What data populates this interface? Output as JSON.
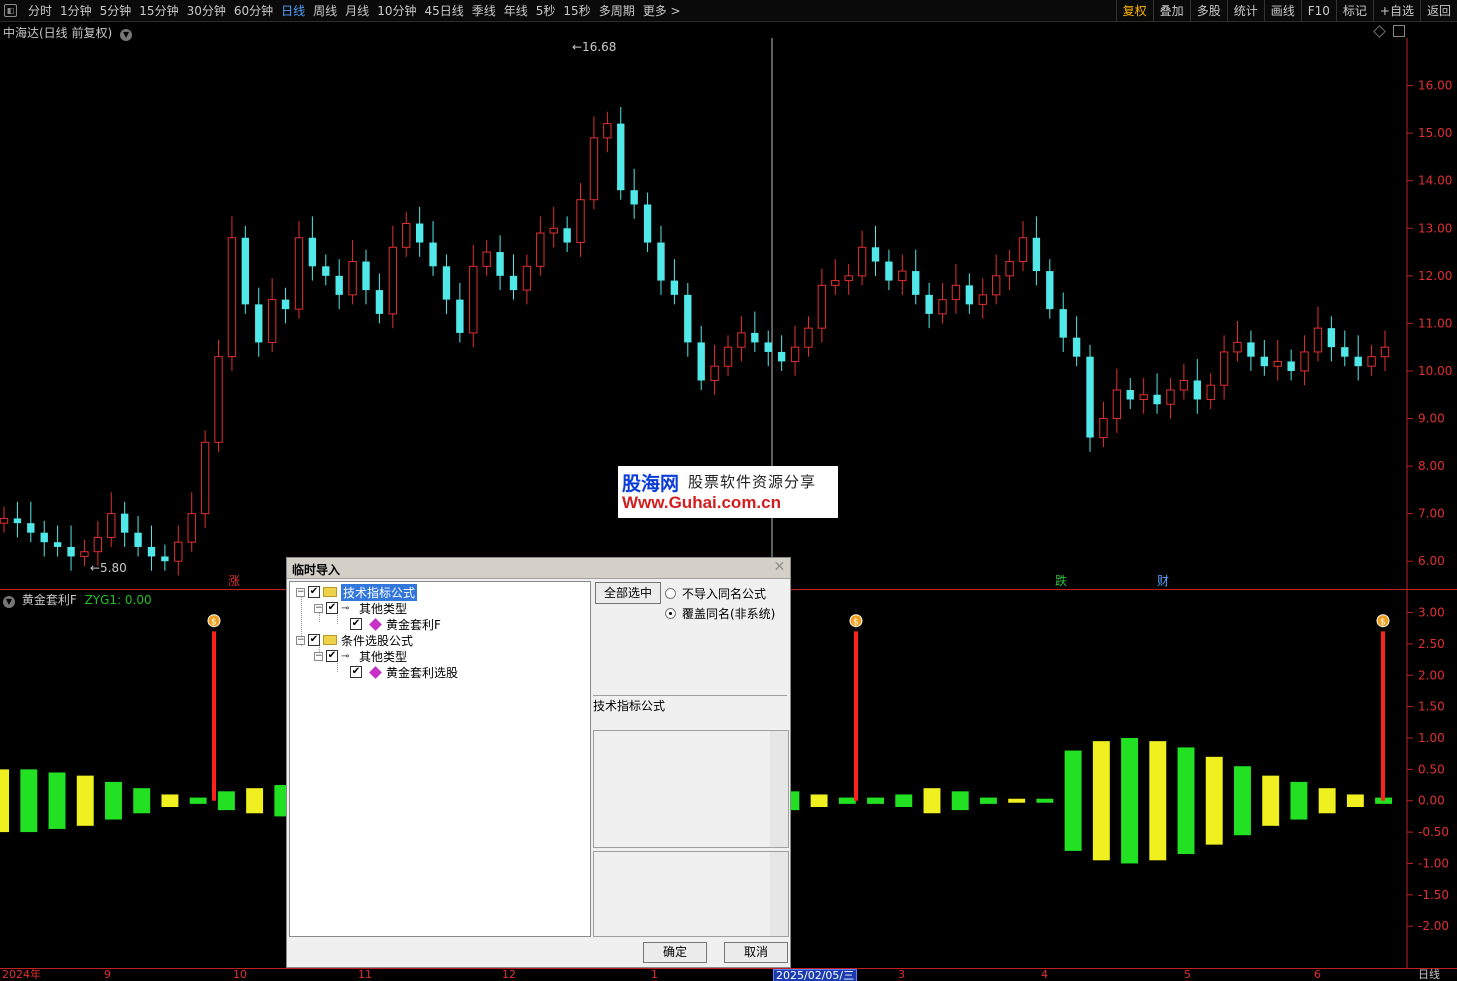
{
  "toolbar": {
    "left": [
      "分时",
      "1分钟",
      "5分钟",
      "15分钟",
      "30分钟",
      "60分钟",
      "日线",
      "周线",
      "月线",
      "10分钟",
      "45日线",
      "季线",
      "年线",
      "5秒",
      "15秒",
      "多周期",
      "更多 >"
    ],
    "active": "日线",
    "right": [
      "复权",
      "叠加",
      "多股",
      "统计",
      "画线",
      "F10",
      "标记",
      "+自选",
      "返回"
    ],
    "right_hot": "复权"
  },
  "main_chart": {
    "title": "中海达(日线 前复权)",
    "high_marker": "16.68",
    "low_marker": "5.80",
    "event_labels": [
      {
        "text": "涨",
        "color": "#e03030"
      },
      {
        "text": "跌",
        "color": "#30c040"
      },
      {
        "text": "财",
        "color": "#5aa0ff"
      }
    ],
    "y_ticks": [
      "16.00",
      "15.00",
      "14.00",
      "13.00",
      "12.00",
      "11.00",
      "10.00",
      "9.00",
      "8.00",
      "7.00",
      "6.00"
    ]
  },
  "indicator": {
    "title": "黄金套利F",
    "value_label": "ZYG1: 0.00",
    "y_ticks": [
      "3.00",
      "2.50",
      "2.00",
      "1.50",
      "1.00",
      "0.50",
      "0.00",
      "-0.50",
      "-1.00",
      "-1.50",
      "-2.00"
    ],
    "signal_icon": "money-bag-icon"
  },
  "date_axis": {
    "labels": [
      "2024年",
      "9",
      "10",
      "11",
      "12",
      "1",
      "2025/02/05/三",
      "3",
      "4",
      "5",
      "6"
    ],
    "corner": "日线"
  },
  "watermark": {
    "brand": "股海网",
    "tagline": "股票软件资源分享",
    "url": "Www.Guhai.com.cn"
  },
  "dialog": {
    "title": "临时导入",
    "tree": [
      {
        "label": "技术指标公式",
        "selected": true
      },
      {
        "label": "其他类型"
      },
      {
        "label": "黄金套利F"
      },
      {
        "label": "条件选股公式"
      },
      {
        "label": "其他类型"
      },
      {
        "label": "黄金套利选股"
      }
    ],
    "select_all": "全部选中",
    "radio_skip": "不导入同名公式",
    "radio_overwrite": "覆盖同名(非系统)",
    "info_label": "技术指标公式",
    "ok": "确定",
    "cancel": "取消"
  },
  "colors": {
    "up": "#e03030",
    "down": "#50e8e8",
    "bar_green": "#22e022",
    "bar_yellow": "#f0f020",
    "signal": "#ff2020"
  },
  "chart_data": [
    {
      "type": "candlestick",
      "title": "中海达(日线 前复权)",
      "ylim": [
        5.5,
        17.0
      ],
      "annotations": {
        "high": 16.68,
        "low": 5.8
      },
      "close_approx": [
        6.9,
        6.8,
        6.6,
        6.4,
        6.3,
        6.1,
        6.2,
        6.5,
        7.0,
        6.6,
        6.3,
        6.1,
        6.0,
        6.4,
        7.0,
        8.5,
        10.3,
        12.8,
        11.4,
        10.6,
        11.5,
        11.3,
        12.8,
        12.2,
        12.0,
        11.6,
        12.3,
        11.7,
        11.2,
        12.6,
        13.1,
        12.7,
        12.2,
        11.5,
        10.8,
        12.2,
        12.5,
        12.0,
        11.7,
        12.2,
        12.9,
        13.0,
        12.7,
        13.6,
        14.9,
        15.2,
        13.8,
        13.5,
        12.7,
        11.9,
        11.6,
        10.6,
        9.8,
        10.1,
        10.5,
        10.8,
        10.6,
        10.4,
        10.2,
        10.5,
        10.9,
        11.8,
        11.9,
        12.0,
        12.6,
        12.3,
        11.9,
        12.1,
        11.6,
        11.2,
        11.5,
        11.8,
        11.4,
        11.6,
        12.0,
        12.3,
        12.8,
        12.1,
        11.3,
        10.7,
        10.3,
        8.6,
        9.0,
        9.6,
        9.4,
        9.5,
        9.3,
        9.6,
        9.8,
        9.4,
        9.7,
        10.4,
        10.6,
        10.3,
        10.1,
        10.2,
        10.0,
        10.4,
        10.9,
        10.5,
        10.3,
        10.1,
        10.3,
        10.5
      ]
    },
    {
      "type": "bar",
      "title": "黄金套利F",
      "series_label": "ZYG1: 0.00",
      "ylim": [
        -2.3,
        3.2
      ],
      "values_approx": [
        0.5,
        0.5,
        0.45,
        0.4,
        0.3,
        0.2,
        0.1,
        0.05,
        0.15,
        0.2,
        0.25,
        0.2,
        0.25,
        0.3,
        0.2,
        0.05,
        0.0,
        -0.5,
        -1.5,
        -2.0,
        -2.3,
        -2.3,
        -2.2,
        0.0,
        0.35,
        0.3,
        0.15,
        -0.1,
        -0.15,
        -0.1,
        -0.05,
        0.05,
        0.1,
        0.2,
        0.15,
        0.05,
        0.0,
        0.0,
        0.8,
        0.95,
        1.0,
        0.95,
        0.85,
        0.7,
        0.55,
        0.4,
        0.3,
        0.2,
        0.1,
        0.05
      ],
      "signals": [
        0,
        3.0
      ]
    }
  ]
}
